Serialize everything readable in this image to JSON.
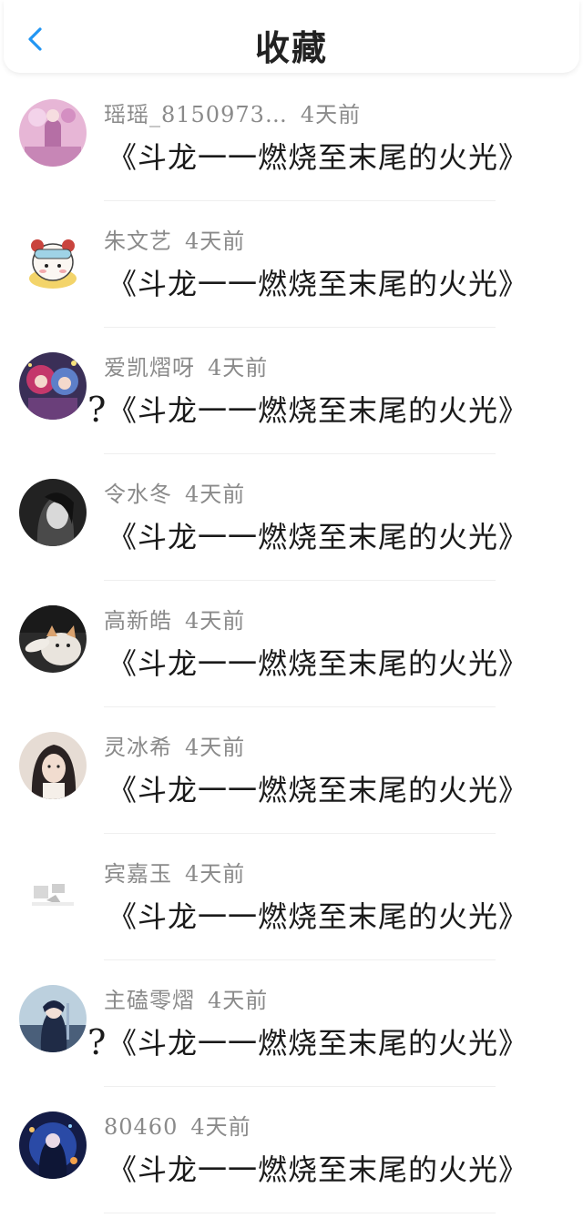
{
  "header": {
    "title": "收藏",
    "back_icon": "chevron-left-icon",
    "accent_color": "#2196f3"
  },
  "items": [
    {
      "name": "瑶瑶_8150973…",
      "time": "4天前",
      "prefix": "",
      "text": "《斗龙一一燃烧至末尾的火光》",
      "avatar_icon": "avatar-pink-girl"
    },
    {
      "name": "朱文艺",
      "time": "4天前",
      "prefix": "",
      "text": "《斗龙一一燃烧至末尾的火光》",
      "avatar_icon": "avatar-panda-cartoon"
    },
    {
      "name": "爱凯熠呀",
      "time": "4天前",
      "prefix": "?",
      "text": "《斗龙一一燃烧至末尾的火光》",
      "avatar_icon": "avatar-anime-duo"
    },
    {
      "name": "令水冬",
      "time": "4天前",
      "prefix": "",
      "text": "《斗龙一一燃烧至末尾的火光》",
      "avatar_icon": "avatar-dark-portrait"
    },
    {
      "name": "高新皓",
      "time": "4天前",
      "prefix": "",
      "text": "《斗龙一一燃烧至末尾的火光》",
      "avatar_icon": "avatar-cat"
    },
    {
      "name": "灵冰希",
      "time": "4天前",
      "prefix": "",
      "text": "《斗龙一一燃烧至末尾的火光》",
      "avatar_icon": "avatar-girl-photo"
    },
    {
      "name": "宾嘉玉",
      "time": "4天前",
      "prefix": "",
      "text": "《斗龙一一燃烧至末尾的火光》",
      "avatar_icon": "avatar-light-sketch"
    },
    {
      "name": "主磕零熠",
      "time": "4天前",
      "prefix": "?",
      "text": "《斗龙一一燃烧至末尾的火光》",
      "avatar_icon": "avatar-anime-boy"
    },
    {
      "name": "80460",
      "time": "4天前",
      "prefix": "",
      "text": "《斗龙一一燃烧至末尾的火光》",
      "avatar_icon": "avatar-blue-fantasy"
    }
  ]
}
